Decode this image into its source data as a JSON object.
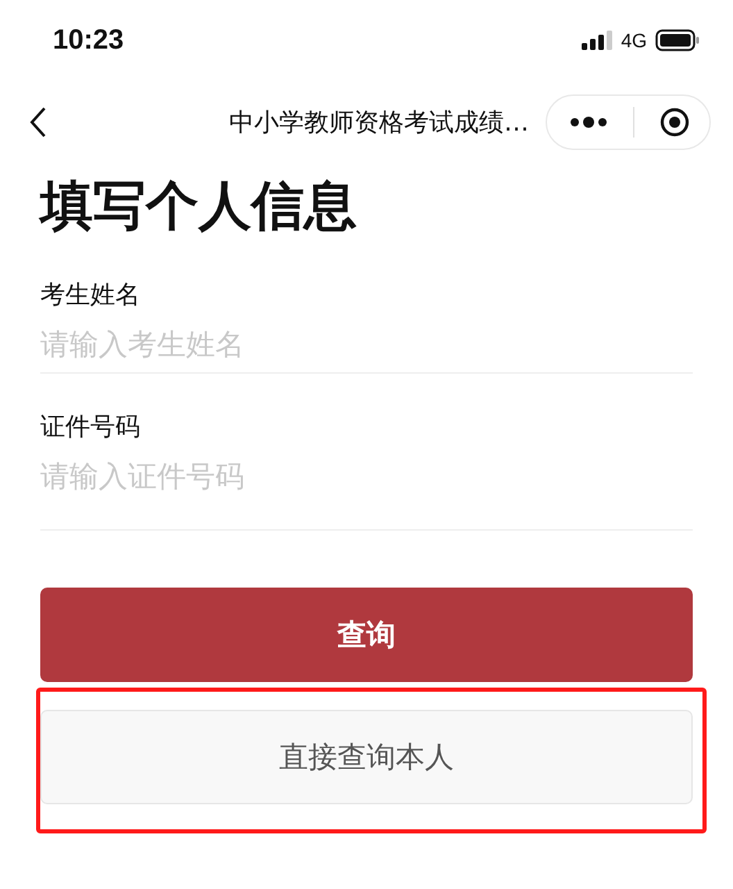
{
  "status_bar": {
    "time": "10:23",
    "network": "4G"
  },
  "nav_bar": {
    "title": "中小学教师资格考试成绩…"
  },
  "heading": "填写个人信息",
  "fields": [
    {
      "label": "考生姓名",
      "placeholder": "请输入考生姓名"
    },
    {
      "label": "证件号码",
      "placeholder": "请输入证件号码"
    }
  ],
  "buttons": [
    {
      "label": "查询",
      "kind": "primary",
      "highlighted": false
    },
    {
      "label": "直接查询本人",
      "kind": "secondary",
      "highlighted": true
    }
  ]
}
